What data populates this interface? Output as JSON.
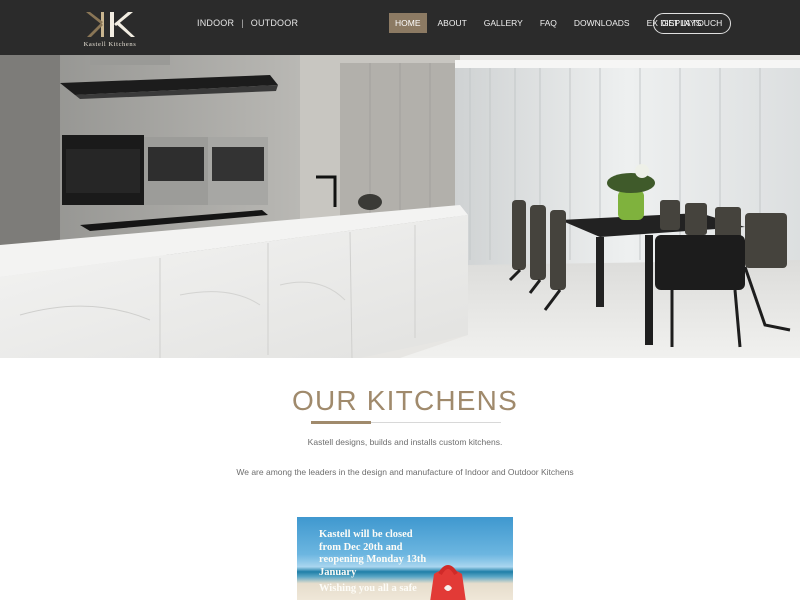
{
  "header": {
    "logo": {
      "monogram": "K",
      "brand_text": "Kastell Kitchens"
    },
    "subnav": [
      "INDOOR",
      "OUTDOOR"
    ],
    "subnav_separator": "|",
    "nav": [
      {
        "label": "HOME",
        "active": true
      },
      {
        "label": "ABOUT",
        "active": false
      },
      {
        "label": "GALLERY",
        "active": false
      },
      {
        "label": "FAQ",
        "active": false
      },
      {
        "label": "DOWNLOADS",
        "active": false
      },
      {
        "label": "EX DISPLAYS",
        "active": false
      }
    ],
    "cta_label": "GET IN TOUCH"
  },
  "hero": {
    "image": "kitchen-interior-photo"
  },
  "content": {
    "title": "OUR KITCHENS",
    "intro_line1": "Kastell designs, builds and installs custom kitchens.",
    "intro_line2": "We are among the leaders in the design and manufacture of Indoor and Outdoor Kitchens"
  },
  "notice": {
    "lines": [
      "Kastell will be closed",
      "from Dec 20th and",
      "reopening Monday 13th",
      "January",
      "Wishing you all a safe"
    ]
  },
  "colors": {
    "header_bg": "#2b2b2b",
    "accent": "#a08a6c",
    "nav_active_bg": "#8c7a63",
    "body_text": "#6e6e6e"
  }
}
